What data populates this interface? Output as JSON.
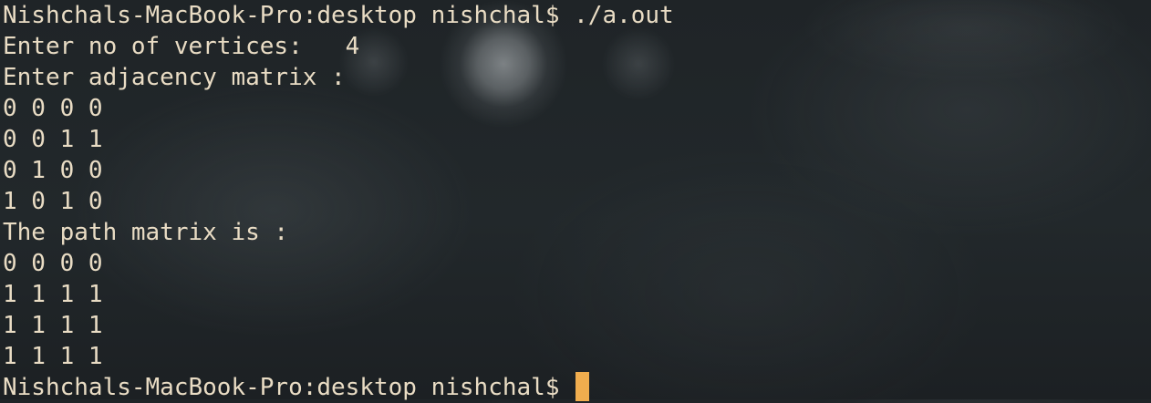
{
  "terminal": {
    "lines": [
      "Nishchals-MacBook-Pro:desktop nishchal$ ./a.out",
      "Enter no of vertices:   4",
      "Enter adjacency matrix :",
      "0 0 0 0",
      "0 0 1 1",
      "0 1 0 0",
      "1 0 1 0",
      "The path matrix is :",
      "0 0 0 0",
      "1 1 1 1",
      "1 1 1 1",
      "1 1 1 1"
    ],
    "prompt": "Nishchals-MacBook-Pro:desktop nishchal$ ",
    "cursor_color": "#f0ad4e",
    "text_color": "#e9dcc4"
  }
}
